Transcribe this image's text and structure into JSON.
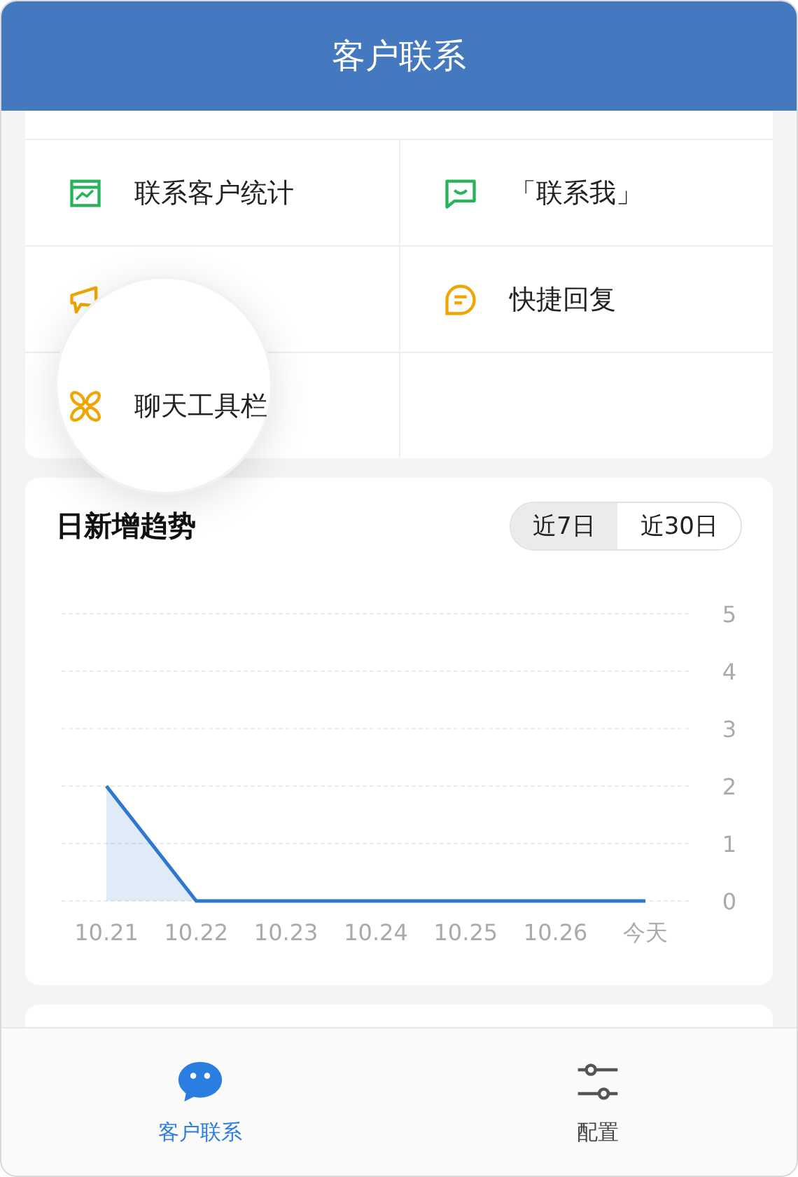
{
  "header": {
    "title": "客户联系"
  },
  "menu": [
    {
      "label": "联系客户统计",
      "highlighted": false
    },
    {
      "label": "「联系我」",
      "highlighted": false
    },
    {
      "highlighted": false
    },
    {
      "label": "快捷回复",
      "highlighted": false
    },
    {
      "label": "聊天工具栏",
      "highlighted": true
    }
  ],
  "trend": {
    "title": "日新增趋势",
    "tabs": [
      {
        "label": "近7日",
        "selected": true
      },
      {
        "label": "近30日",
        "selected": false
      }
    ],
    "chart_data": {
      "type": "area",
      "categories": [
        "10.21",
        "10.22",
        "10.23",
        "10.24",
        "10.25",
        "10.26",
        "今天"
      ],
      "series": [
        {
          "color": "#2f78d0",
          "values": [
            2,
            0,
            0,
            0,
            0,
            0,
            0
          ]
        }
      ],
      "ylim": [
        0,
        5
      ],
      "yticks": [
        0,
        1,
        2,
        3,
        4,
        5
      ],
      "grid": true
    }
  },
  "tabbar": [
    {
      "label": "客户联系",
      "selected": true
    },
    {
      "label": "配置",
      "selected": false
    }
  ]
}
